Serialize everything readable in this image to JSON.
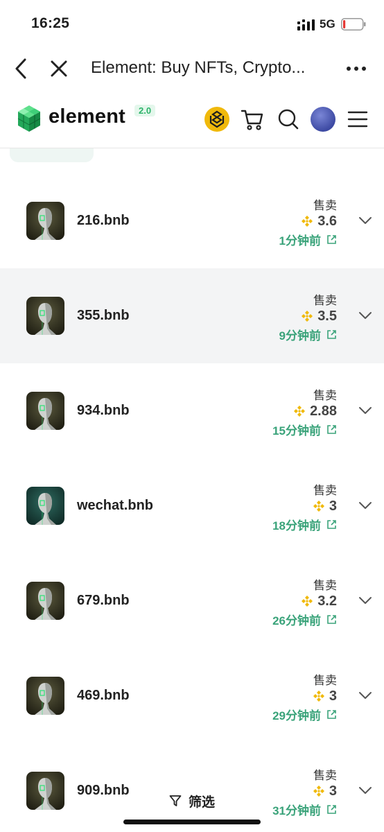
{
  "status_bar": {
    "time": "16:25",
    "network": "5G",
    "battery_level": 0.12,
    "battery_color": "#e53935"
  },
  "browser": {
    "title": "Element: Buy NFTs, Crypto..."
  },
  "site": {
    "logo_text": "element",
    "version": "2.0",
    "accent_color": "#3aa37a",
    "bnb_color": "#f0b90b"
  },
  "activity": [
    {
      "name": "216.bnb",
      "event": "售卖",
      "price": "3.6",
      "time": "1分钟前",
      "thumb": "statue-dark"
    },
    {
      "name": "355.bnb",
      "event": "售卖",
      "price": "3.5",
      "time": "9分钟前",
      "thumb": "statue-dark",
      "highlighted": true
    },
    {
      "name": "934.bnb",
      "event": "售卖",
      "price": "2.88",
      "time": "15分钟前",
      "thumb": "statue-dark"
    },
    {
      "name": "wechat.bnb",
      "event": "售卖",
      "price": "3",
      "time": "18分钟前",
      "thumb": "statue-teal"
    },
    {
      "name": "679.bnb",
      "event": "售卖",
      "price": "3.2",
      "time": "26分钟前",
      "thumb": "statue-dark"
    },
    {
      "name": "469.bnb",
      "event": "售卖",
      "price": "3",
      "time": "29分钟前",
      "thumb": "statue-dark"
    },
    {
      "name": "909.bnb",
      "event": "售卖",
      "price": "3",
      "time": "31分钟前",
      "thumb": "statue-dark"
    }
  ],
  "filter": {
    "label": "筛选"
  }
}
